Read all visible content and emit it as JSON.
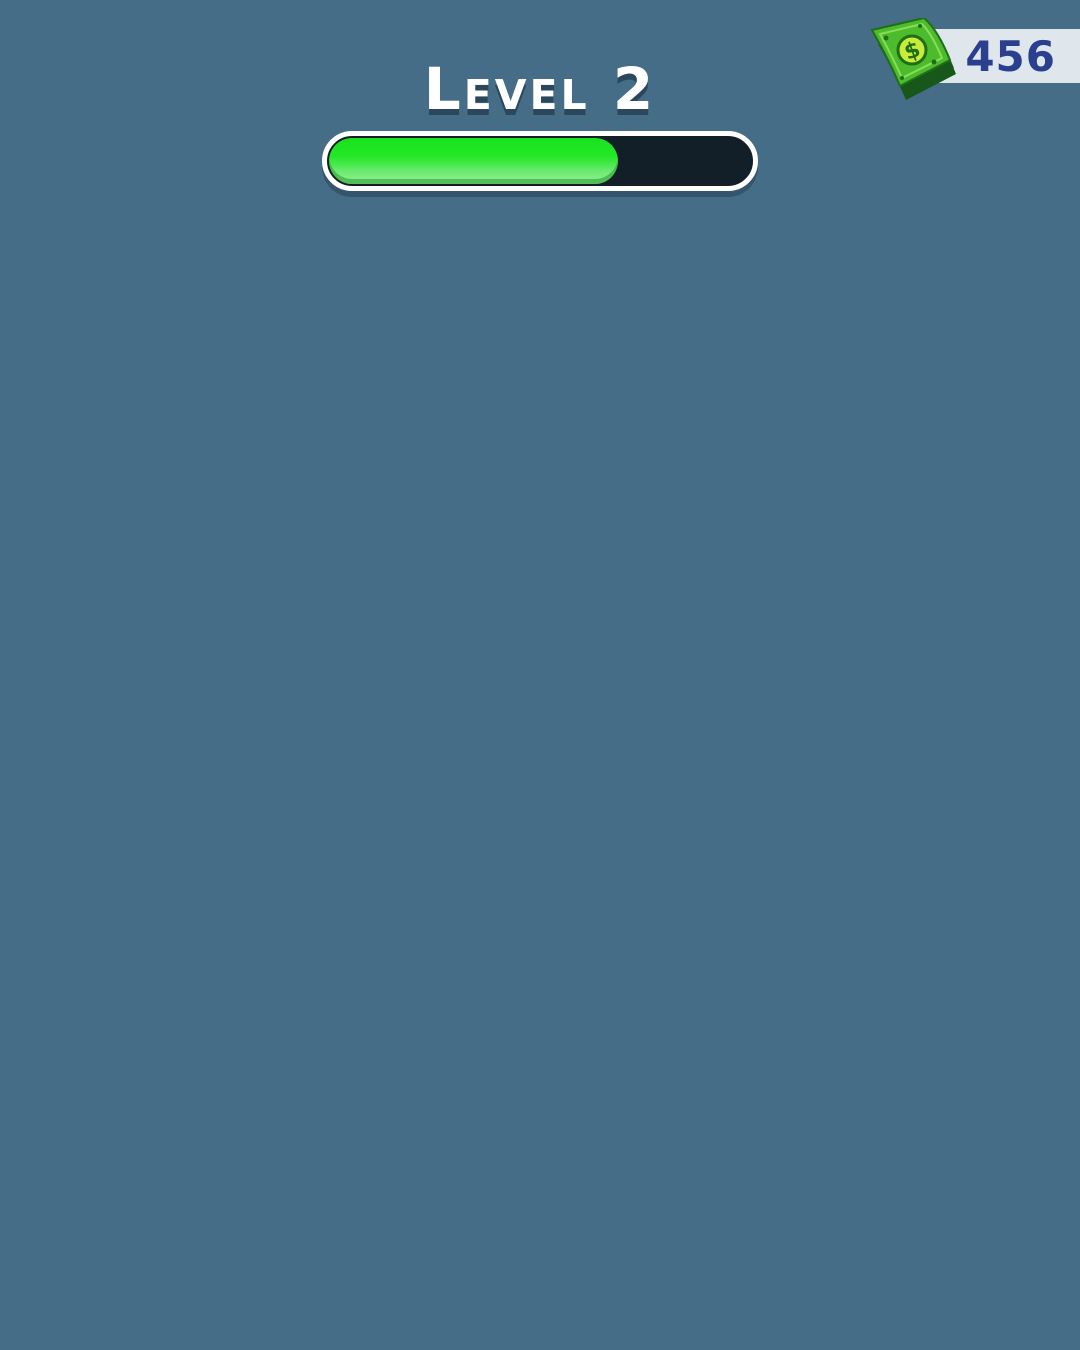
{
  "hud": {
    "level_label": "Level 2",
    "progress": 0.685,
    "currency": {
      "icon": "cash-stack-icon",
      "amount": "456",
      "color": "#2b3f8f"
    }
  },
  "colors": {
    "background": "#466d87",
    "progress_fill": "#23e827",
    "progress_track": "#121f28",
    "cash_green": "#3ea82a"
  }
}
